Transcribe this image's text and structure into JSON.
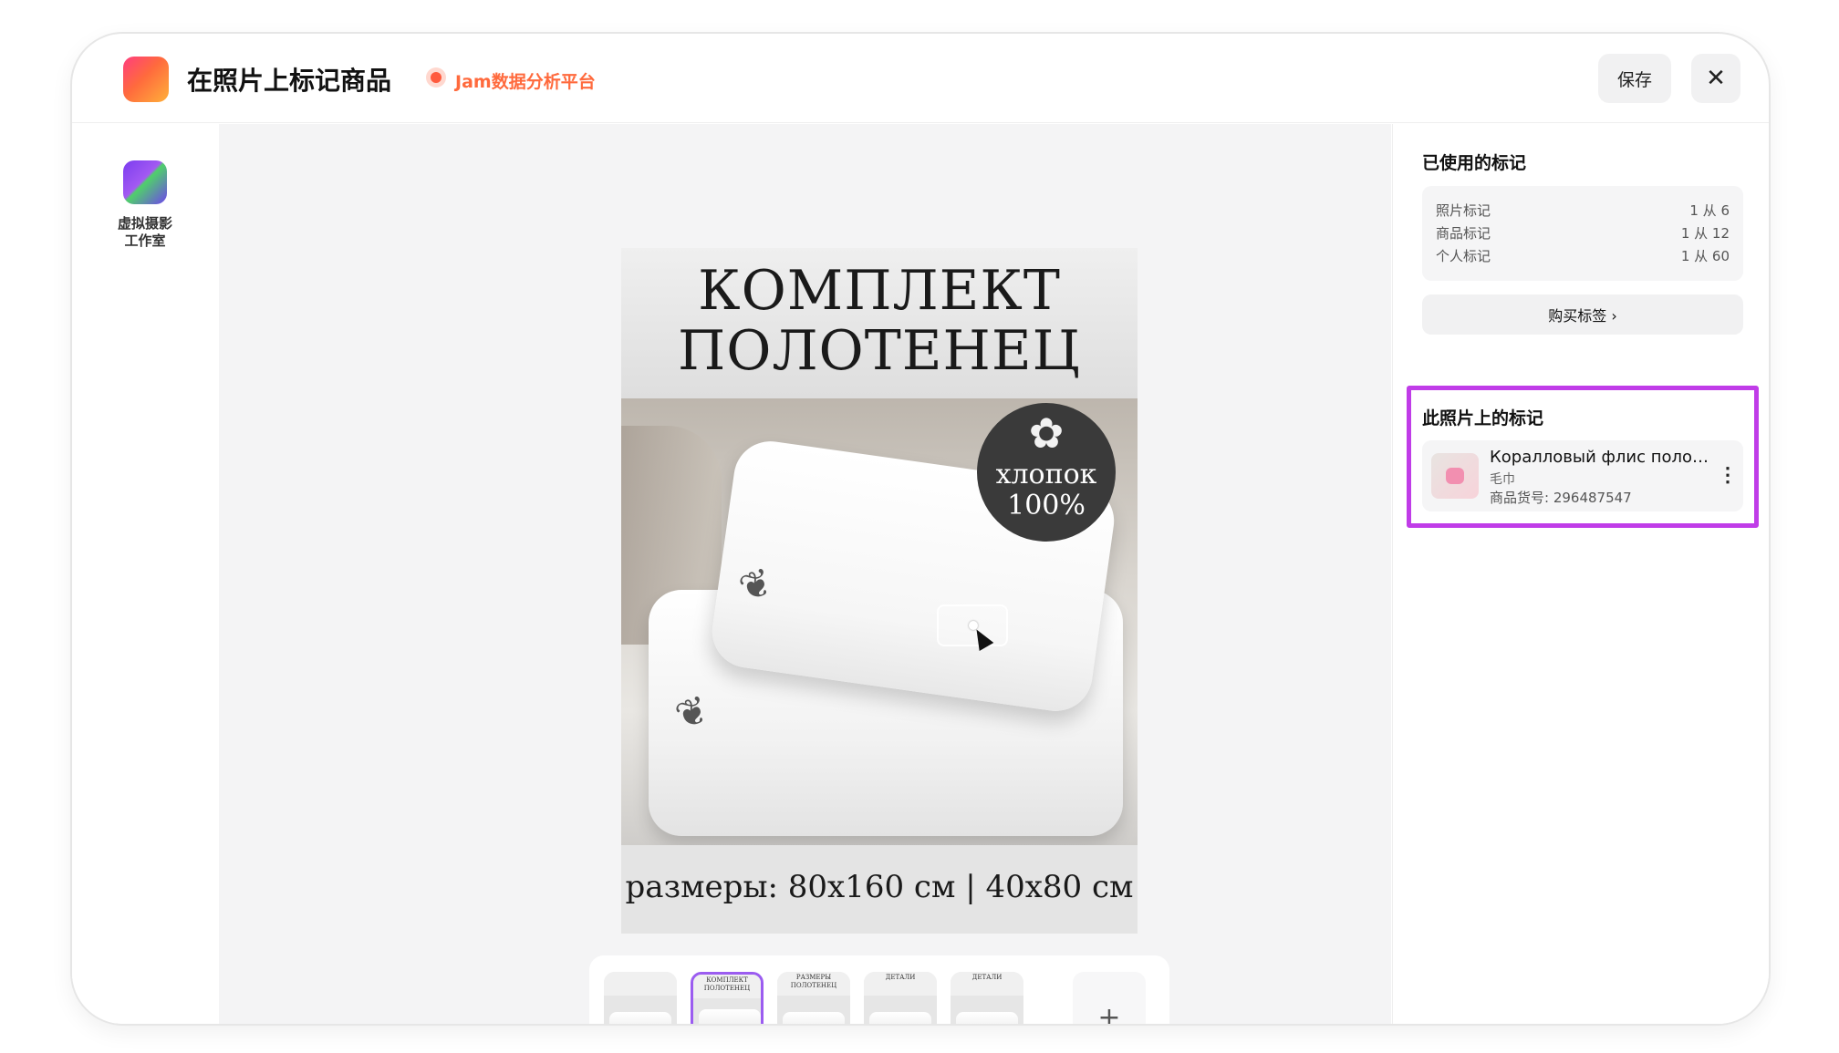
{
  "header": {
    "title": "在照片上标记商品",
    "brand": "Jam数据分析平台",
    "save_label": "保存",
    "close_label": "✕"
  },
  "rail": {
    "label_line1": "虚拟摄影",
    "label_line2": "工作室"
  },
  "photo": {
    "title_line1": "КОМПЛЕКТ",
    "title_line2": "ПОЛОТЕНЕЦ",
    "badge_line1": "хлопок",
    "badge_line2": "100%",
    "sizes": "размеры: 80х160 см | 40х80 см"
  },
  "thumbnails": {
    "items": [
      {
        "head": ""
      },
      {
        "head": "КОМПЛЕКТ ПОЛОТЕНЕЦ"
      },
      {
        "head": "РАЗМЕРЫ ПОЛОТЕНЕЦ"
      },
      {
        "head": "ДЕТАЛИ"
      },
      {
        "head": "ДЕТАЛИ"
      }
    ],
    "selected_index": 1,
    "add_label": "+"
  },
  "panel": {
    "used_title": "已使用的标记",
    "usage": [
      {
        "label": "照片标记",
        "value": "1 从 6"
      },
      {
        "label": "商品标记",
        "value": "1 从 12"
      },
      {
        "label": "个人标记",
        "value": "1 从 60"
      }
    ],
    "buy_label": "购买标签 ›",
    "photo_tags_title": "此照片上的标记",
    "tag_item": {
      "name": "Коралловый флис полотенце",
      "category": "毛巾",
      "sku": "商品货号:  296487547",
      "more_label": "⋮"
    }
  },
  "colors": {
    "accent_purple": "#c03ce8",
    "brand_orange": "#ff6a3d",
    "selected_thumb": "#9b5cf0"
  }
}
